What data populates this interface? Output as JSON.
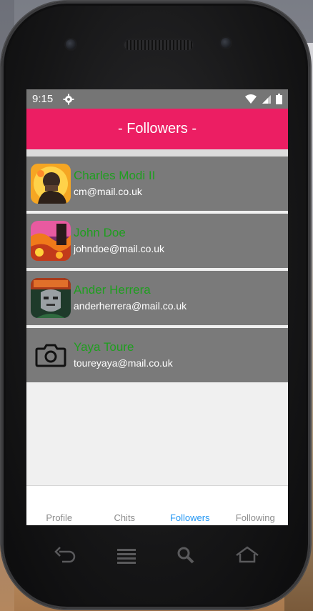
{
  "status_bar": {
    "time": "9:15"
  },
  "header": {
    "title": "- Followers -"
  },
  "followers": [
    {
      "name": "Charles Modi II",
      "email": "cm@mail.co.uk",
      "avatar": "portrait-avatar-orange"
    },
    {
      "name": "John Doe",
      "email": "johndoe@mail.co.uk",
      "avatar": "fire-landscape-avatar"
    },
    {
      "name": "Ander Herrera",
      "email": "anderherrera@mail.co.uk",
      "avatar": "doom-mask-avatar"
    },
    {
      "name": "Yaya Toure",
      "email": "toureyaya@mail.co.uk",
      "avatar": "camera-icon"
    }
  ],
  "tabs": [
    {
      "label": "Profile",
      "active": false
    },
    {
      "label": "Chits",
      "active": false
    },
    {
      "label": "Followers",
      "active": true
    },
    {
      "label": "Following",
      "active": false
    }
  ],
  "colors": {
    "header": "#ec1e63",
    "name": "#1f9e1f",
    "active_tab": "#2196f3"
  },
  "device_nav": [
    "back-icon",
    "menu-icon",
    "search-icon",
    "home-icon"
  ]
}
